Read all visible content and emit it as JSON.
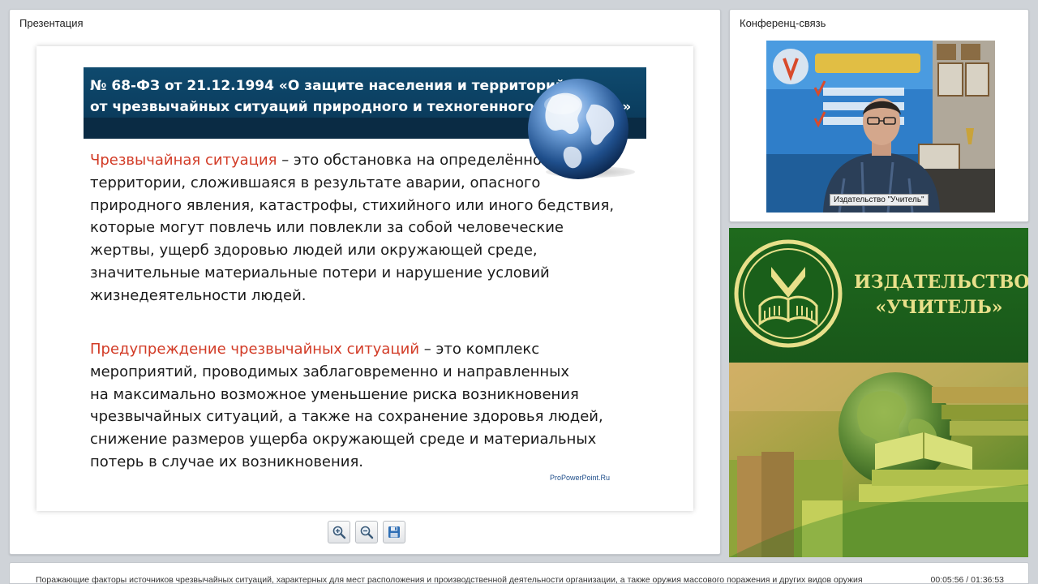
{
  "presentation_panel": {
    "title": "Презентация",
    "slide": {
      "banner_line1": "№ 68-ФЗ от 21.12.1994 «О защите населения и территорий",
      "banner_line2": "от чрезвычайных ситуаций природного и техногенного характера»",
      "para1": {
        "term": "Чрезвычайная ситуация",
        "line1_rest": " – это обстановка на определённой",
        "lines": [
          "территории, сложившаяся в результате аварии, опасного",
          "природного явления, катастрофы, стихийного или иного бедствия,",
          "которые могут повлечь или повлекли за собой человеческие",
          "жертвы, ущерб здоровью людей или окружающей среде,",
          "значительные материальные потери и нарушение условий",
          "жизнедеятельности людей."
        ]
      },
      "para2": {
        "term": "Предупреждение чрезвычайных ситуаций",
        "line1_rest": " – это комплекс",
        "lines": [
          "мероприятий, проводимых заблаговременно и направленных",
          "на максимально возможное уменьшение риска возникновения",
          "чрезвычайных ситуаций, а также на сохранение здоровья людей,",
          "снижение размеров ущерба окружающей среде и материальных",
          "потерь в случае их возникновения."
        ]
      },
      "watermark": "ProPowerPoint.Ru"
    },
    "toolbar": {
      "zoom_in_icon": "zoom-in-icon",
      "zoom_out_icon": "zoom-out-icon",
      "save_icon": "floppy-disk-icon"
    }
  },
  "conference_panel": {
    "title": "Конференц-связь",
    "video_label": "Издательство \"Учитель\""
  },
  "publisher_banner": {
    "name_line1": "ИЗДАТЕЛЬСТВО",
    "name_line2": "«УЧИТЕЛЬ»"
  },
  "status_bar": {
    "text": "Поражающие факторы источников чрезвычайных ситуаций, характерных для мест расположения и производственной деятельности организации, а также оружия массового поражения и других видов оружия",
    "time": "00:05:56 / 01:36:53"
  },
  "colors": {
    "accent_term": "#d23b26",
    "banner_blue": "#0f4a6e",
    "publisher_green": "#1f6a1d",
    "publisher_gold": "#e8e08a"
  }
}
